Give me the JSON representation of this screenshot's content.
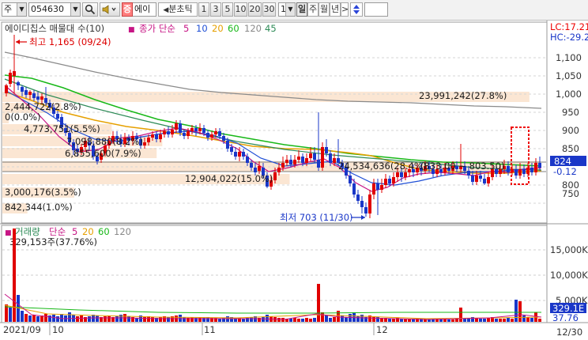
{
  "toolbar": {
    "market": "주",
    "code": "054630",
    "name_tag": "증",
    "name": "에이",
    "period_label": "분초틱",
    "periods": [
      "1",
      "3",
      "5",
      "10",
      "20",
      "30"
    ],
    "count": "1",
    "units": [
      "일",
      "주",
      "월",
      "년"
    ]
  },
  "price_panel": {
    "title": "에이디칩스 매물대 수(10)",
    "ma_label": "종가 단순",
    "ma_periods": [
      "5",
      "10",
      "20",
      "60",
      "120",
      "45"
    ],
    "ma_colors": [
      "#c71585",
      "#1f4fd6",
      "#e6a000",
      "#18b818",
      "#888888",
      "#2e8b57"
    ],
    "lc": "LC:17.21",
    "hc": "HC:-29.2",
    "high_label": "최고 1,165 (09/24)",
    "low_label": "최저 703 (11/30)",
    "current_price": "824",
    "change": "-0.12",
    "price_ticks": [
      "1,100",
      "1,050",
      "1,000",
      "950",
      "900",
      "850",
      "800",
      "750"
    ],
    "volume_profile": [
      {
        "label": "23,991,242(27.8%)",
        "pct": 27.8
      },
      {
        "label": "2,444,722(2.8%)",
        "pct": 2.8
      },
      {
        "label": "0(0.0%)",
        "pct": 0.0
      },
      {
        "label": "4,773,751(5.5%)",
        "pct": 5.5
      },
      {
        "label": "7,098,880(8.2%)",
        "pct": 8.2
      },
      {
        "label": "6,855,600(7.9%)",
        "pct": 7.9
      },
      {
        "label": "24,534,636(28.4%)",
        "pct": 28.4
      },
      {
        "label": "12,904,022(15.0%)",
        "pct": 15.0
      },
      {
        "label": "3,000,176(3.5%)",
        "pct": 3.5
      },
      {
        "label": "842,344(1.0%)",
        "pct": 1.0
      }
    ],
    "poc_label": "(833.00 ~ 803.50)"
  },
  "volume_panel": {
    "title": "거래량",
    "ma_label": "단순",
    "ma_periods": [
      "5",
      "20",
      "60",
      "120"
    ],
    "max_label": "329,153주(37.76%)",
    "ticks": [
      "15,000K",
      "10,000K",
      "5,000K"
    ],
    "current_label": "329.1E",
    "current_pct": "37.76"
  },
  "x_axis": {
    "labels": [
      "2021/09",
      "10",
      "11",
      "12",
      "12/30"
    ]
  },
  "chart_data": {
    "type": "candlestick",
    "price_axis": {
      "min": 700,
      "max": 1165
    },
    "high": 1165,
    "low": 703,
    "close": 824,
    "volume_axis": {
      "max_k": 18000
    }
  }
}
